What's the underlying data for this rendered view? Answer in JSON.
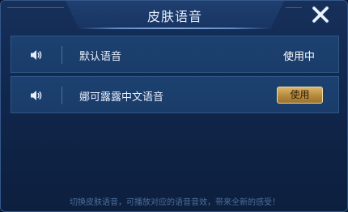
{
  "dialog": {
    "title": "皮肤语音",
    "close_icon": "close-icon"
  },
  "voices": [
    {
      "name": "默认语音",
      "status": "使用中",
      "icon": "speaker-icon"
    },
    {
      "name": "娜可露露中文语音",
      "button_label": "使用",
      "icon": "speaker-icon"
    }
  ],
  "footer": {
    "hint": "切换皮肤语音，可播放对应的语音音效，带来全新的感受！"
  },
  "colors": {
    "panel": "#122a52",
    "row": "#1c4170",
    "accent_gold": "#c9a258",
    "text": "#e8eefb",
    "hint": "#4d6f9c"
  }
}
